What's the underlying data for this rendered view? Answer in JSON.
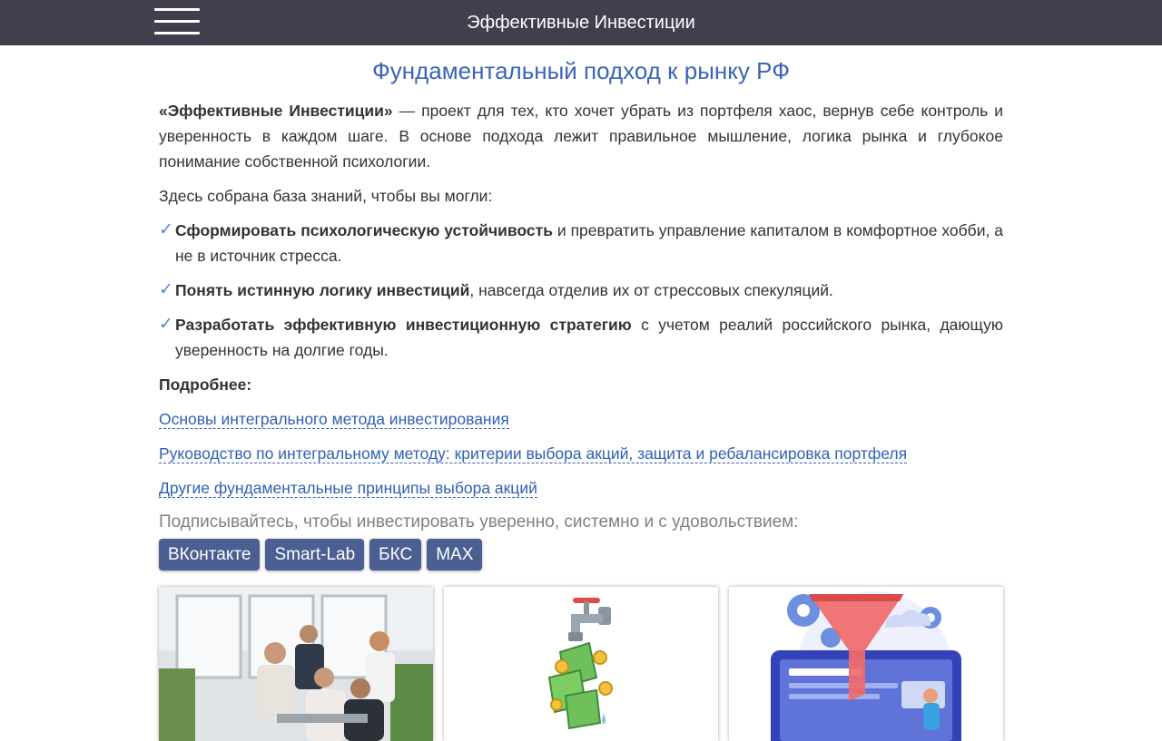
{
  "header": {
    "title": "Эффективные Инвестиции"
  },
  "main": {
    "title": "Фундаментальный подход к рынку РФ",
    "intro_bold": "«Эффективные Инвестиции»",
    "intro_rest": " — проект для тех, кто хочет убрать из портфеля хаос, вернув себе контроль и уверенность в каждом шаге. В основе подхода лежит правильное мышление, логика рынка и глубокое понимание собственной психологии.",
    "lead": "Здесь собрана база знаний, чтобы вы могли:",
    "check_glyph": "✓",
    "points": [
      {
        "bold": "Сформировать психологическую устойчивость",
        "rest": " и превратить управление капиталом в комфортное хобби, а не в источник стресса."
      },
      {
        "bold": "Понять истинную логику инвестиций",
        "rest": ", навсегда отделив их от стрессовых спекуляций."
      },
      {
        "bold": "Разработать эффективную инвестиционную стратегию",
        "rest": " с учетом реалий российского рынка, дающую уверенность на долгие годы."
      }
    ],
    "more_label": "Подробнее:",
    "links": [
      "Основы интегрального метода инвестирования",
      "Руководство по интегральному методу: критерии выбора акций, защита и ребалансировка портфеля",
      "Другие фундаментальные принципы выбора акций"
    ],
    "subscribe_text": "Подписывайтесь, чтобы инвестировать уверенно, системно и с удовольствием:",
    "social": [
      "ВКонтакте",
      "Smart-Lab",
      "БКС",
      "MAX"
    ]
  },
  "cards": [
    {
      "icon": "team-photo"
    },
    {
      "icon": "money-faucet-icon"
    },
    {
      "icon": "funnel-dashboard-icon"
    }
  ],
  "colors": {
    "header_bg": "#3f3f4e",
    "title_blue": "#3a64b8",
    "link_blue": "#2f5fb6",
    "check_blue": "#5b86d4",
    "social_btn": "#4c5f92"
  }
}
